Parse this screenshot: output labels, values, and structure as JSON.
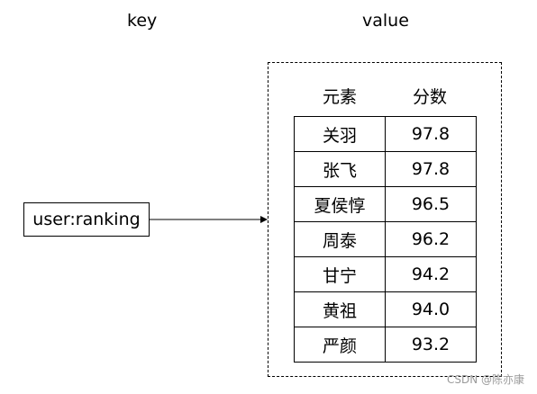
{
  "labels": {
    "key": "key",
    "value": "value"
  },
  "key_name": "user:ranking",
  "table": {
    "headers": [
      "元素",
      "分数"
    ],
    "rows": [
      {
        "member": "关羽",
        "score": "97.8"
      },
      {
        "member": "张飞",
        "score": "97.8"
      },
      {
        "member": "夏侯惇",
        "score": "96.5"
      },
      {
        "member": "周泰",
        "score": "96.2"
      },
      {
        "member": "甘宁",
        "score": "94.2"
      },
      {
        "member": "黄祖",
        "score": "94.0"
      },
      {
        "member": "严颜",
        "score": "93.2"
      }
    ]
  },
  "watermark": "CSDN @陈亦康"
}
